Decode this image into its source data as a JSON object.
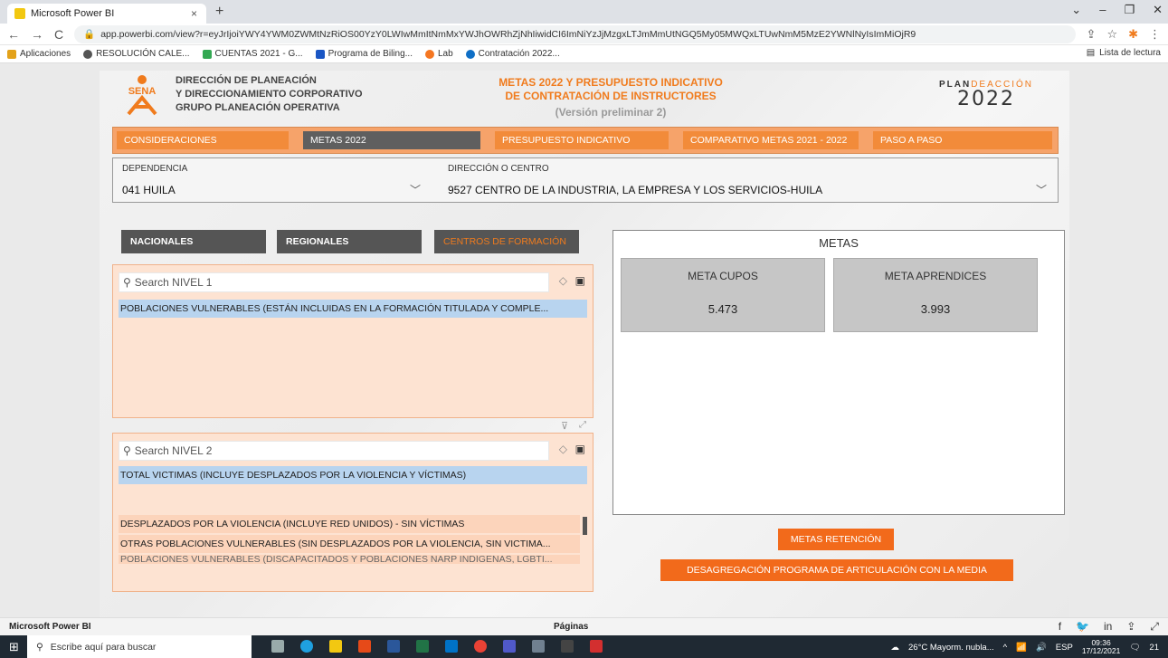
{
  "browser": {
    "tab_title": "Microsoft Power BI",
    "tab_close": "×",
    "new_tab": "+",
    "win_min": "⌄",
    "win_dash": "–",
    "win_max": "❐",
    "win_close": "✕",
    "url": "app.powerbi.com/view?r=eyJrIjoiYWY4YWM0ZWMtNzRiOS00YzY0LWIwMmItNmMxYWJhOWRhZjNhIiwidCI6ImNiYzJjMzgxLTJmMmUtNGQ5My05MWQxLTUwNmM5MzE2YWNlNyIsImMiOjR9",
    "bookmarks": [
      "Aplicaciones",
      "RESOLUCIÓN CALE...",
      "CUENTAS 2021 - G...",
      "Programa de Biling...",
      "Lab",
      "Contratación 2022..."
    ],
    "reading_list": "Lista de lectura"
  },
  "header": {
    "left_line1": "DIRECCIÓN DE PLANEACIÓN",
    "left_line2": "Y DIRECCIONAMIENTO CORPORATIVO",
    "left_line3": "GRUPO PLANEACIÓN OPERATIVA",
    "logo_text": "SENA",
    "center_line1": "METAS 2022 Y PRESUPUESTO INDICATIVO",
    "center_line2": "DE CONTRATACIÓN DE INSTRUCTORES",
    "center_sub": "(Versión preliminar 2)",
    "right_plan": "PLAN",
    "right_de": "DE",
    "right_accion": "ACCIÓN",
    "right_year": "2022"
  },
  "navbar": [
    "CONSIDERACIONES",
    "METAS 2022",
    "PRESUPUESTO INDICATIVO",
    "COMPARATIVO METAS 2021 - 2022",
    "PASO A PASO"
  ],
  "filters": {
    "dependencia_label": "DEPENDENCIA",
    "dependencia_value": "041 HUILA",
    "centro_label": "DIRECCIÓN O CENTRO",
    "centro_value": "9527 CENTRO DE LA INDUSTRIA, LA EMPRESA Y LOS SERVICIOS-HUILA"
  },
  "scope_buttons": [
    "NACIONALES",
    "REGIONALES",
    "CENTROS DE FORMACIÓN"
  ],
  "slicer1": {
    "placeholder": "Search NIVEL 1",
    "items": [
      "POBLACIONES VULNERABLES (ESTÁN INCLUIDAS EN LA FORMACIÓN TITULADA Y COMPLE..."
    ]
  },
  "slicer2": {
    "placeholder": "Search NIVEL 2",
    "items": [
      "TOTAL VICTIMAS (INCLUYE DESPLAZADOS POR LA VIOLENCIA Y VÍCTIMAS)",
      "DESPLAZADOS POR LA VIOLENCIA (INCLUYE RED UNIDOS) - SIN VÍCTIMAS",
      "OTRAS POBLACIONES VULNERABLES (SIN DESPLAZADOS POR LA VIOLENCIA, SIN VICTIMA...",
      "POBLACIONES VULNERABLES (DISCAPACITADOS Y POBLACIONES NARP INDÍGENAS, LGBTI..."
    ]
  },
  "metas": {
    "title": "METAS",
    "cupos_label": "META CUPOS",
    "cupos_value": "5.473",
    "aprendices_label": "META APRENDICES",
    "aprendices_value": "3.993"
  },
  "buttons": {
    "retencion": "METAS RETENCIÓN",
    "desagregacion": "DESAGREGACIÓN PROGRAMA DE ARTICULACIÓN CON LA MEDIA"
  },
  "footer": {
    "left": "Microsoft Power BI",
    "center": "Páginas"
  },
  "taskbar": {
    "search": "Escribe aquí para buscar",
    "weather": "26°C  Mayorm. nubla...",
    "lang": "ESP",
    "time": "09:36",
    "date": "17/12/2021",
    "notif_count": "21"
  }
}
